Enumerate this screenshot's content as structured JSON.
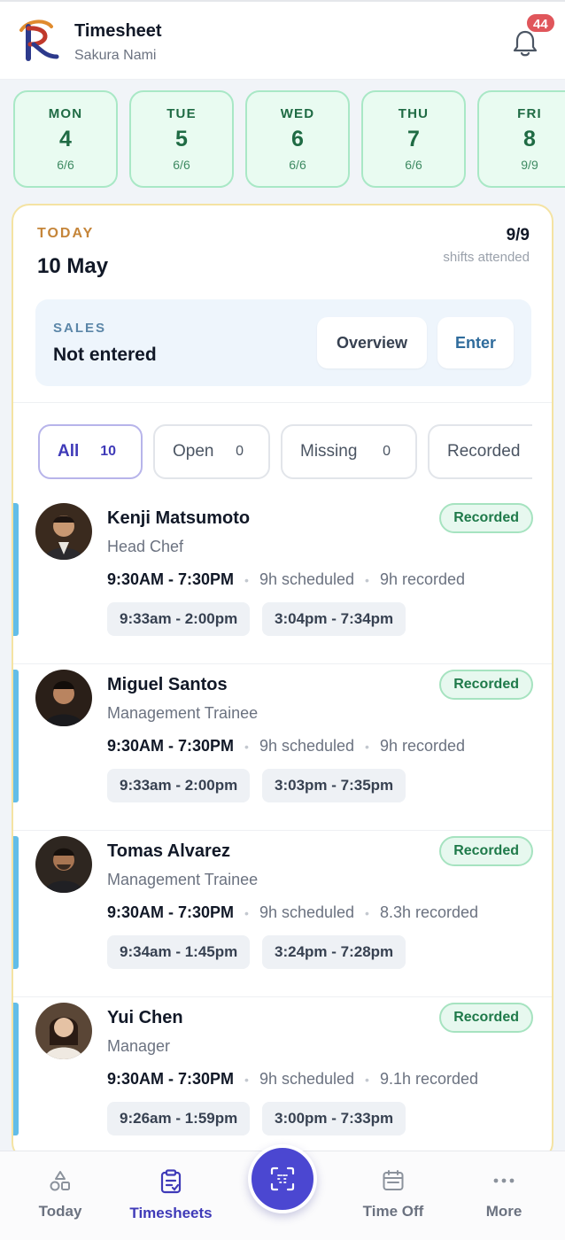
{
  "header": {
    "title": "Timesheet",
    "subtitle": "Sakura Nami",
    "notification_count": "44",
    "logo_icon": "brand-logo",
    "bell_icon": "bell-icon"
  },
  "days": [
    {
      "name": "MON",
      "num": "4",
      "ratio": "6/6"
    },
    {
      "name": "TUE",
      "num": "5",
      "ratio": "6/6"
    },
    {
      "name": "WED",
      "num": "6",
      "ratio": "6/6"
    },
    {
      "name": "THU",
      "num": "7",
      "ratio": "6/6"
    },
    {
      "name": "FRI",
      "num": "8",
      "ratio": "9/9"
    }
  ],
  "today": {
    "label": "TODAY",
    "date": "10 May",
    "shifts": "9/9",
    "shifts_label": "shifts attended"
  },
  "sales": {
    "label": "SALES",
    "value": "Not entered",
    "overview_label": "Overview",
    "enter_label": "Enter"
  },
  "filters": [
    {
      "label": "All",
      "count": "10"
    },
    {
      "label": "Open",
      "count": "0"
    },
    {
      "label": "Missing",
      "count": "0"
    },
    {
      "label": "Recorded",
      "count": ""
    }
  ],
  "employees": [
    {
      "name": "Kenji Matsumoto",
      "role": "Head Chef",
      "status": "Recorded",
      "time": "9:30AM - 7:30PM",
      "scheduled": "9h scheduled",
      "recorded": "9h recorded",
      "segments": [
        "9:33am - 2:00pm",
        "3:04pm - 7:34pm"
      ]
    },
    {
      "name": "Miguel Santos",
      "role": "Management Trainee",
      "status": "Recorded",
      "time": "9:30AM - 7:30PM",
      "scheduled": "9h scheduled",
      "recorded": "9h recorded",
      "segments": [
        "9:33am - 2:00pm",
        "3:03pm - 7:35pm"
      ]
    },
    {
      "name": "Tomas Alvarez",
      "role": "Management Trainee",
      "status": "Recorded",
      "time": "9:30AM - 7:30PM",
      "scheduled": "9h scheduled",
      "recorded": "8.3h recorded",
      "segments": [
        "9:34am - 1:45pm",
        "3:24pm - 7:28pm"
      ]
    },
    {
      "name": "Yui Chen",
      "role": "Manager",
      "status": "Recorded",
      "time": "9:30AM - 7:30PM",
      "scheduled": "9h scheduled",
      "recorded": "9.1h recorded",
      "segments": [
        "9:26am - 1:59pm",
        "3:00pm - 7:33pm"
      ]
    }
  ],
  "nav": {
    "today": "Today",
    "timesheets": "Timesheets",
    "time_off": "Time Off",
    "more": "More",
    "scan_icon": "scan-icon"
  },
  "colors": {
    "accent": "#4b47d1",
    "day_bg": "#e9fbf1",
    "status_green": "#1f7a4a",
    "row_accent": "#63bde8",
    "badge": "#e0565b"
  }
}
